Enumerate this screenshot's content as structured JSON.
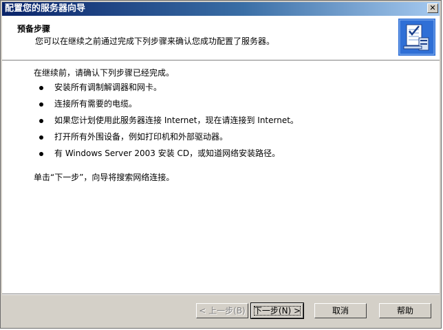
{
  "window": {
    "title": "配置您的服务器向导",
    "close_glyph": "✕"
  },
  "header": {
    "title": "预备步骤",
    "subtitle": "您可以在继续之前通过完成下列步骤来确认您成功配置了服务器。",
    "icon": "wizard-checklist-icon"
  },
  "content": {
    "intro": "在继续前，请确认下列步骤已经完成。",
    "items": [
      "安装所有调制解调器和网卡。",
      "连接所有需要的电缆。",
      "如果您计划使用此服务器连接 Internet，现在请连接到 Internet。",
      "打开所有外围设备，例如打印机和外部驱动器。",
      "有 Windows Server 2003 安装 CD，或知道网络安装路径。"
    ],
    "outro": "单击“下一步”，向导将搜索网络连接。"
  },
  "buttons": {
    "back": "< 上一步(B)",
    "next": "下一步(N) >",
    "cancel": "取消",
    "help": "帮助"
  },
  "colors": {
    "titlebar_start": "#0a246a",
    "titlebar_end": "#a6caf0",
    "dialog_face": "#d4d0c8",
    "icon_blue": "#2f6fd6"
  }
}
